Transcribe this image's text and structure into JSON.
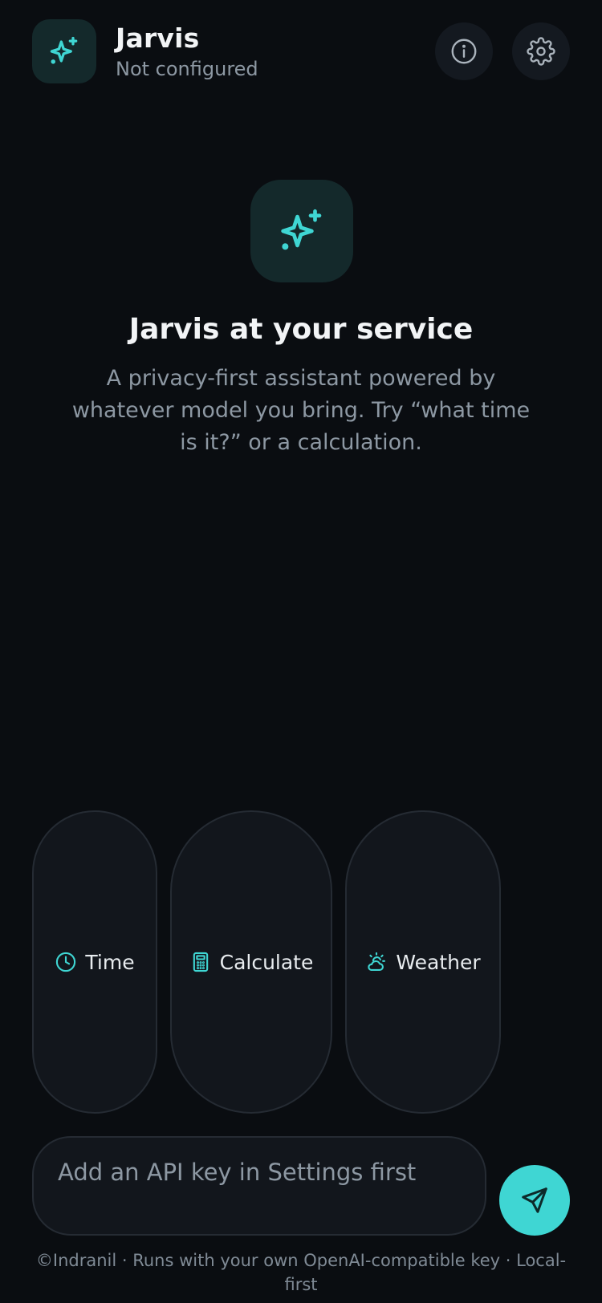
{
  "header": {
    "title": "Jarvis",
    "status": "Not configured",
    "logo_icon": "sparkles-icon",
    "info_icon": "info-icon",
    "settings_icon": "gear-icon"
  },
  "hero": {
    "icon": "sparkles-icon",
    "title": "Jarvis at your service",
    "description": "A privacy-first assistant powered by whatever model you bring. Try “what time is it?” or a calculation."
  },
  "chips": [
    {
      "label": "Time",
      "icon": "clock-icon"
    },
    {
      "label": "Calculate",
      "icon": "calculator-icon"
    },
    {
      "label": "Weather",
      "icon": "weather-icon"
    }
  ],
  "composer": {
    "placeholder": "Add an API key in Settings first",
    "value": "",
    "send_icon": "send-icon"
  },
  "footer": {
    "text": "©Indranil · Runs with your own OpenAI-compatible key · Local-first"
  },
  "colors": {
    "background": "#0a0d11",
    "accent": "#3fd6d3",
    "surface": "#12161c",
    "icon_tile": "#14292b",
    "muted_text": "#8d98a3"
  }
}
